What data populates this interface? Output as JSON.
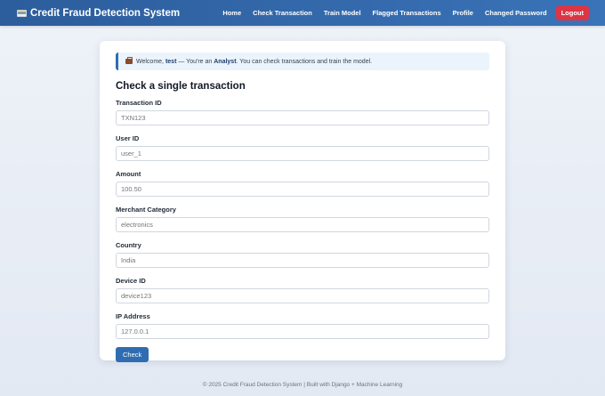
{
  "navbar": {
    "brand": "Credit Fraud Detection System",
    "links": [
      "Home",
      "Check Transaction",
      "Train Model",
      "Flagged Transactions",
      "Profile",
      "Changed Password"
    ],
    "logout": "Logout"
  },
  "alert": {
    "welcome": "Welcome,",
    "username": "test",
    "middle": "— You're an",
    "role": "Analyst",
    "tail": ". You can check transactions and train the model."
  },
  "form": {
    "title": "Check a single transaction",
    "fields": [
      {
        "label": "Transaction ID",
        "placeholder": "TXN123"
      },
      {
        "label": "User ID",
        "placeholder": "user_1"
      },
      {
        "label": "Amount",
        "placeholder": "100.50"
      },
      {
        "label": "Merchant Category",
        "placeholder": "electronics"
      },
      {
        "label": "Country",
        "placeholder": "India"
      },
      {
        "label": "Device ID",
        "placeholder": "device123"
      },
      {
        "label": "IP Address",
        "placeholder": "127.0.0.1"
      }
    ],
    "submit": "Check"
  },
  "footer": "© 2025 Credit Fraud Detection System | Built with Django + Machine Learning",
  "colors": {
    "navbar": "#2c5d9c",
    "accent": "#2f6db0",
    "logout": "#dc3545"
  }
}
